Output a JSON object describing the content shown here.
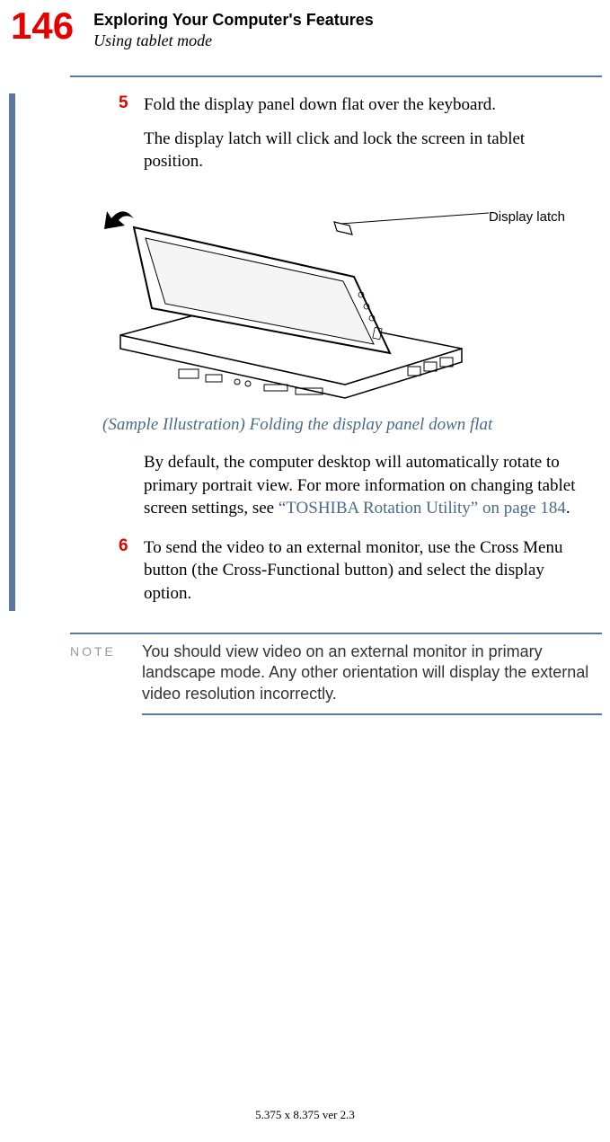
{
  "page_number": "146",
  "chapter_title": "Exploring Your Computer's Features",
  "section_title": "Using tablet mode",
  "steps": [
    {
      "num": "5",
      "lead": "Fold the display panel down flat over the keyboard.",
      "follow": "The display latch will click and lock the screen in tablet position."
    },
    {
      "num": "6",
      "lead": "To send the video to an external monitor, use the Cross Menu button (the Cross-Functional button) and select the display option."
    }
  ],
  "figure": {
    "callout": "Display latch",
    "caption": "(Sample Illustration) Folding the display panel down flat"
  },
  "paragraph_after_figure": {
    "pre": "By default, the computer desktop will automatically rotate to primary portrait view. For more information on changing tablet screen settings, see ",
    "link": "“TOSHIBA Rotation Utility” on page 184",
    "post": "."
  },
  "note": {
    "label": "NOTE",
    "text": "You should view video on an external monitor in primary landscape mode. Any other orientation will display the external video resolution incorrectly."
  },
  "footer": "5.375 x 8.375 ver 2.3"
}
